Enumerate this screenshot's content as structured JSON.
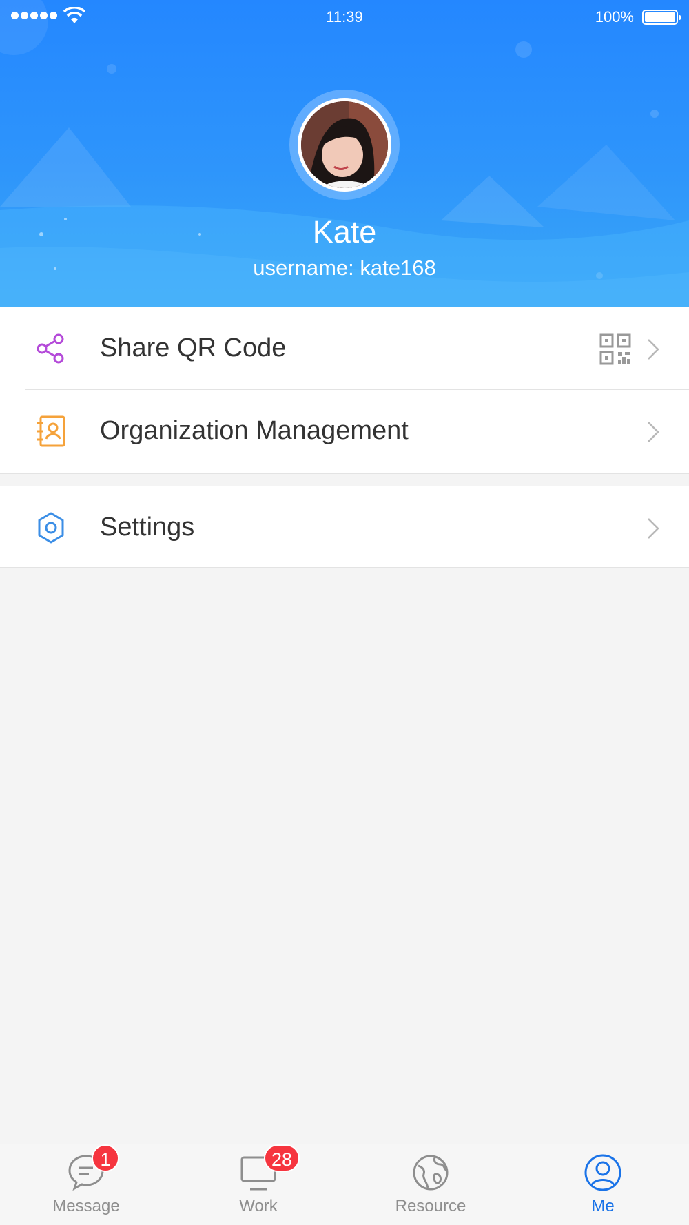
{
  "status_bar": {
    "time": "11:39",
    "battery": "100%"
  },
  "profile": {
    "name": "Kate",
    "username": "username: kate168"
  },
  "menu": {
    "share_qr": "Share QR Code",
    "organization": "Organization Management",
    "settings": "Settings"
  },
  "tabs": [
    {
      "label": "Message",
      "badge": "1",
      "icon": "message-icon"
    },
    {
      "label": "Work",
      "badge": "28",
      "icon": "monitor-icon"
    },
    {
      "label": "Resource",
      "icon": "globe-icon"
    },
    {
      "label": "Me",
      "icon": "user-icon",
      "active": true
    }
  ],
  "colors": {
    "header_blue": "#2487ff",
    "active_tab": "#1a73e8",
    "badge_red": "#f6353f",
    "share_icon": "#b44ad9",
    "org_icon": "#f5a23a",
    "settings_icon": "#3b8ee6"
  }
}
